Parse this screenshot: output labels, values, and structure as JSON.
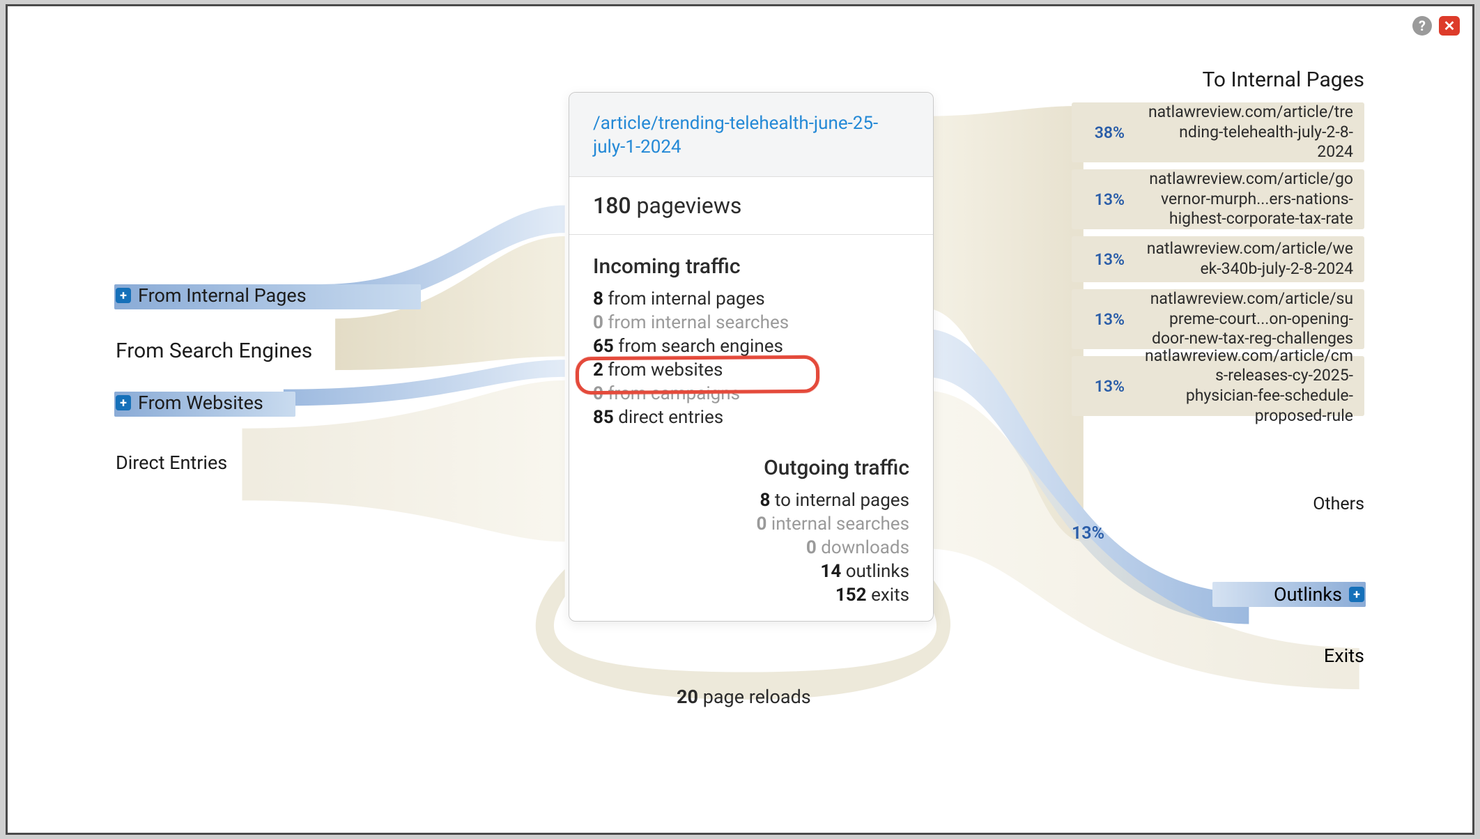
{
  "page": {
    "url_path": "/article/trending-telehealth-june-25-july-1-2024",
    "pageviews_value": "180",
    "pageviews_label": "pageviews",
    "page_reloads_value": "20",
    "page_reloads_label": "page reloads"
  },
  "incoming": {
    "title": "Incoming traffic",
    "rows": [
      {
        "value": "8",
        "label": "from internal pages",
        "zero": false
      },
      {
        "value": "0",
        "label": "from internal searches",
        "zero": true
      },
      {
        "value": "65",
        "label": "from search engines",
        "zero": false,
        "highlight": true
      },
      {
        "value": "2",
        "label": "from websites",
        "zero": false
      },
      {
        "value": "0",
        "label": "from campaigns",
        "zero": true
      },
      {
        "value": "85",
        "label": "direct entries",
        "zero": false
      }
    ]
  },
  "outgoing": {
    "title": "Outgoing traffic",
    "rows": [
      {
        "value": "8",
        "label": "to internal pages",
        "zero": false
      },
      {
        "value": "0",
        "label": "internal searches",
        "zero": true
      },
      {
        "value": "0",
        "label": "downloads",
        "zero": true
      },
      {
        "value": "14",
        "label": "outlinks",
        "zero": false
      },
      {
        "value": "152",
        "label": "exits",
        "zero": false
      }
    ]
  },
  "left_sources": {
    "from_internal": "From Internal Pages",
    "from_search": "From Search Engines",
    "from_websites": "From Websites",
    "direct": "Direct Entries"
  },
  "right_dest": {
    "title": "To Internal Pages",
    "items": [
      {
        "pct": "38%",
        "url": "natlawreview.com/article/trending-telehealth-july-2-8-2024"
      },
      {
        "pct": "13%",
        "url": "natlawreview.com/article/governor-murph...ers-nations-highest-corporate-tax-rate"
      },
      {
        "pct": "13%",
        "url": "natlawreview.com/article/week-340b-july-2-8-2024"
      },
      {
        "pct": "13%",
        "url": "natlawreview.com/article/supreme-court...on-opening-door-new-tax-reg-challenges"
      },
      {
        "pct": "13%",
        "url": "natlawreview.com/article/cms-releases-cy-2025-physician-fee-schedule-proposed-rule"
      }
    ],
    "others_pct": "13%",
    "others_label": "Others",
    "outlinks": "Outlinks",
    "exits": "Exits"
  },
  "icons": {
    "help": "?",
    "close": "✕",
    "plus": "+"
  }
}
